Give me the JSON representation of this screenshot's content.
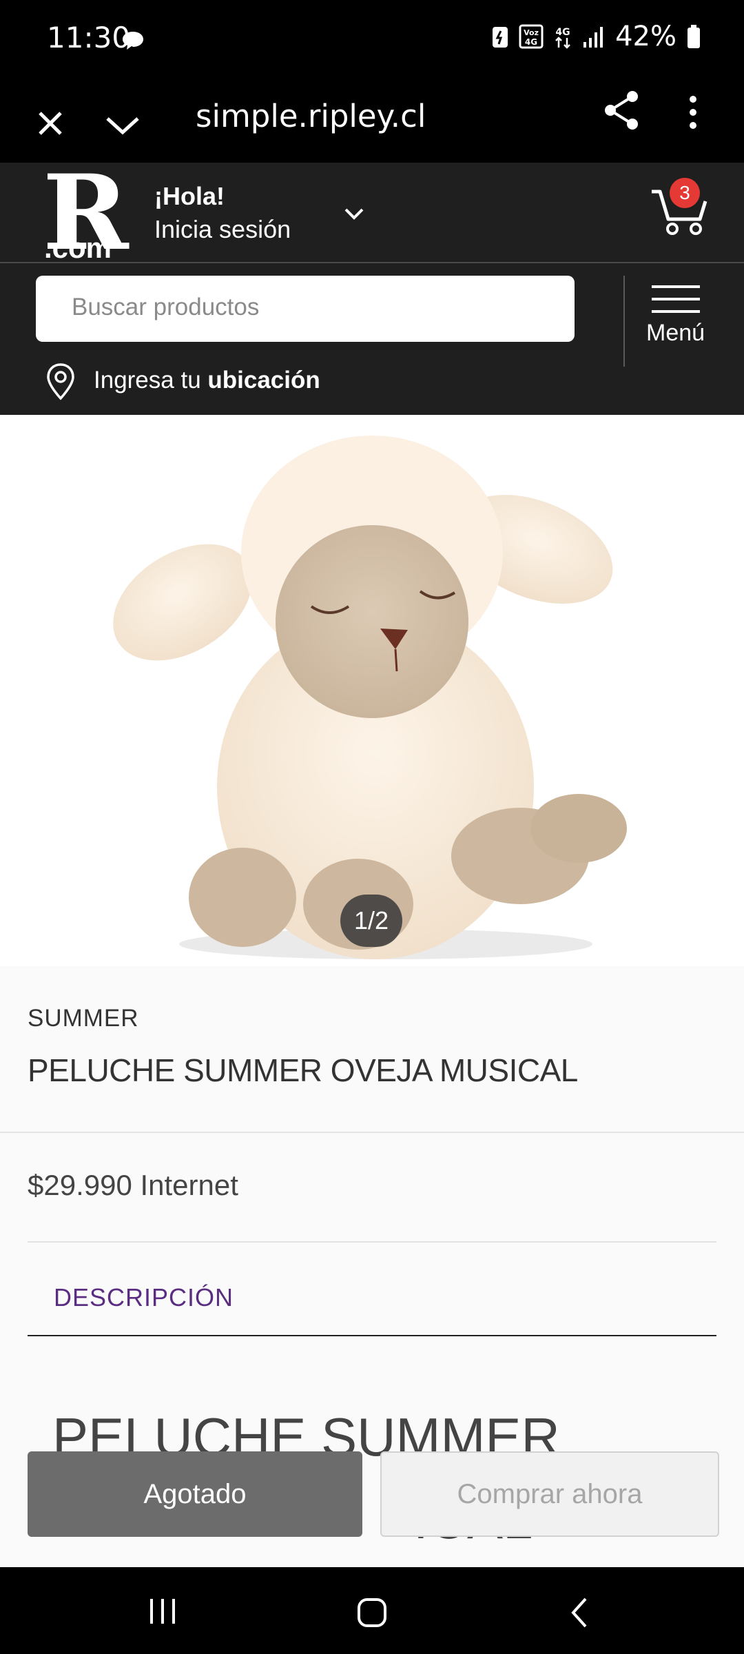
{
  "status_bar": {
    "time": "11:30",
    "battery": "42%"
  },
  "browser": {
    "url": "simple.ripley.cl"
  },
  "header": {
    "logo_letter": "R",
    "logo_suffix": ".com",
    "greeting": "¡Hola!",
    "login_text": "Inicia sesión",
    "cart_count": "3",
    "menu_label": "Menú",
    "search_placeholder": "Buscar productos",
    "location_prefix": "Ingresa tu ",
    "location_bold": "ubicación"
  },
  "product": {
    "image_counter": "1/2",
    "brand": "SUMMER",
    "title": "PELUCHE SUMMER OVEJA MUSICAL",
    "price": "$29.990 Internet",
    "tab_label": "DESCRIPCIÓN",
    "description_heading": "PELUCHE SUMMER",
    "description_heading_2": "ICAL"
  },
  "actions": {
    "sold_out_label": "Agotado",
    "buy_now_label": "Comprar ahora"
  },
  "colors": {
    "header_bg": "#1f1f1f",
    "accent_purple": "#5a2d82",
    "cart_badge": "#e53935"
  }
}
